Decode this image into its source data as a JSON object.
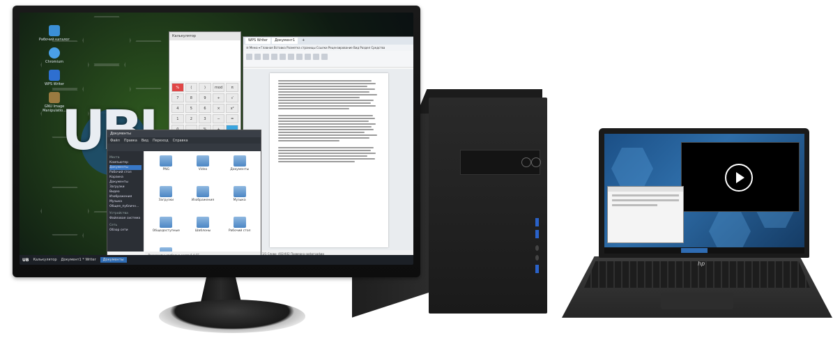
{
  "monitor": {
    "brand_text": "UBLi",
    "desktop_icons": [
      {
        "name": "Рабочий\nкаталог",
        "color": "#3b8fd6"
      },
      {
        "name": "Chromium",
        "color": "#4aa0e6"
      },
      {
        "name": "WPS Writer",
        "color": "#2e6fd0"
      },
      {
        "name": "GNU Image\nManipulatio...",
        "color": "#9a7a40"
      }
    ],
    "calculator": {
      "title": "Калькулятор",
      "keys": [
        "%",
        "(",
        ")",
        "mod",
        "π",
        "7",
        "8",
        "9",
        "÷",
        "√",
        "4",
        "5",
        "6",
        "×",
        "x²",
        "1",
        "2",
        "3",
        "−",
        "=",
        "0",
        ",",
        "%",
        "+",
        ""
      ]
    },
    "editor": {
      "tabs": [
        "WPS Writer",
        "Документ1"
      ],
      "menu": "☰ Меню  ▾  Главная  Вставка  Разметка страницы  Ссылки  Рецензирование  Вид  Раздел  Средства",
      "status": "Страница: 1/1   Слово: 402/402   Проверка орфографии"
    },
    "file_manager": {
      "title": "Документы",
      "menu": [
        "Файл",
        "Правка",
        "Вид",
        "Переход",
        "Справка"
      ],
      "sidebar_head": "Места",
      "sidebar_items": [
        "Компьютер",
        "Документы",
        "Рабочий стол",
        "Корзина",
        "Документы",
        "Загрузки",
        "Видео",
        "Изображения",
        "Музыка",
        "Общее_публичн..."
      ],
      "sidebar_head2": "Устройства",
      "sidebar_device": "Файловая система",
      "sidebar_head3": "Сеть",
      "sidebar_net": "Обзор сети",
      "files": [
        "PNG",
        "Video",
        "Документы",
        "Загрузки",
        "Изображения",
        "Музыка",
        "Общедоступные",
        "Шаблоны",
        "Рабочий стол",
        "Шаблоны"
      ],
      "status": "Документы: свободно места 5.0 ГБ"
    },
    "taskbar": {
      "logo": "UB",
      "items": [
        "Калькулятор",
        "Документ1 * Writer",
        "Документы"
      ]
    }
  },
  "laptop": {
    "logo": "hp"
  }
}
